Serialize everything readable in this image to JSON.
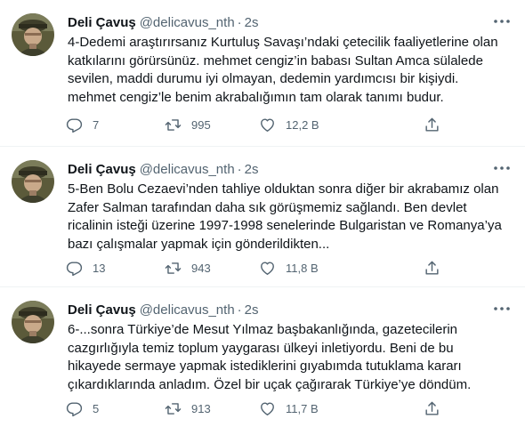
{
  "author": {
    "name": "Deli Çavuş",
    "handle": "@delicavus_nth",
    "separator": "·"
  },
  "tweets": [
    {
      "time": "2s",
      "text": "4-Dedemi araştırırsanız Kurtuluş Savaşı’ndaki çetecilik faaliyetlerine olan katkılarını görürsünüz. mehmet cengiz’in babası Sultan Amca sülalede sevilen, maddi durumu iyi olmayan, dedemin yardımcısı bir kişiydi. mehmet cengiz’le benim akrabalığımın tam olarak tanımı budur.",
      "replies": "7",
      "retweets": "995",
      "likes": "12,2 B"
    },
    {
      "time": "2s",
      "text": "5-Ben Bolu Cezaevi’nden tahliye olduktan sonra diğer bir akrabamız olan Zafer Salman tarafından daha sık görüşmemiz sağlandı. Ben devlet ricalinin isteği üzerine 1997-1998 senelerinde Bulgaristan ve Romanya’ya bazı çalışmalar yapmak için gönderildikten...",
      "replies": "13",
      "retweets": "943",
      "likes": "11,8 B"
    },
    {
      "time": "2s",
      "text": "6-...sonra Türkiye’de Mesut Yılmaz başbakanlığında, gazetecilerin cazgırlığıyla temiz toplum yaygarası ülkeyi inletiyordu. Beni de bu hikayede sermaye yapmak istediklerini gıyabımda tutuklama kararı çıkardıklarında anladım. Özel bir uçak çağırarak Türkiye’ye döndüm.",
      "replies": "5",
      "retweets": "913",
      "likes": "11,7 B"
    }
  ],
  "icons": {
    "more": "more-horizontal-icon",
    "reply": "reply-icon",
    "retweet": "retweet-icon",
    "like": "heart-icon",
    "share": "share-icon"
  },
  "colors": {
    "text": "#0f1419",
    "secondary": "#536471",
    "divider": "#eff3f4"
  }
}
